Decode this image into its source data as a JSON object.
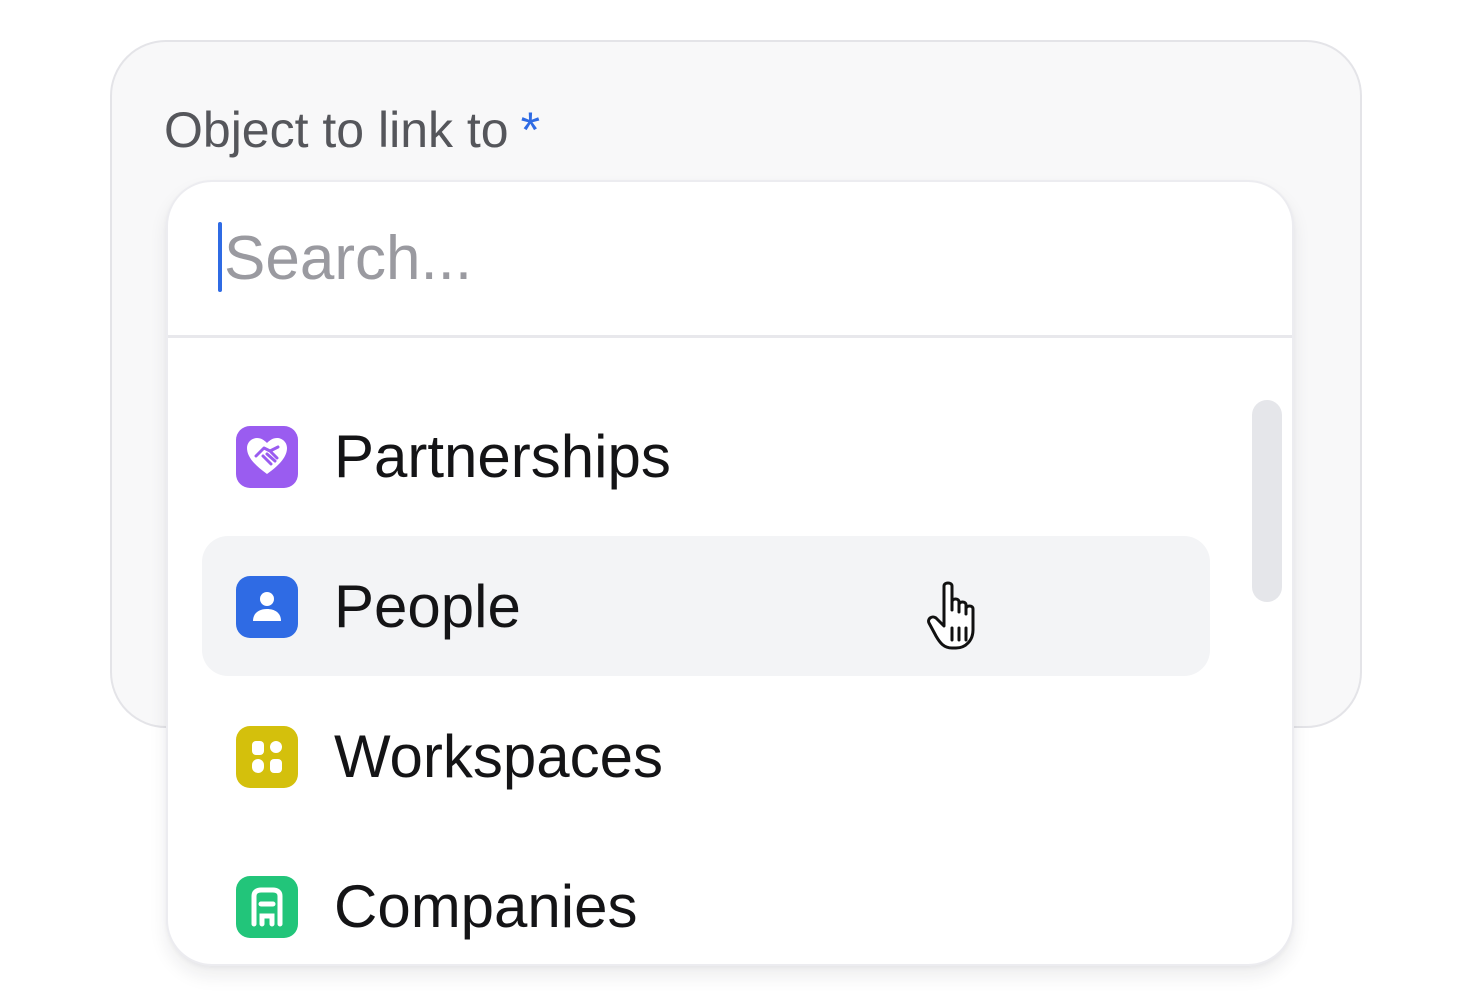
{
  "field": {
    "label": "Object to link to",
    "required_marker": "*"
  },
  "search": {
    "placeholder": "Search...",
    "value": ""
  },
  "objects": [
    {
      "label": "Partnerships",
      "icon": "handshake-heart-icon",
      "color": "#9a5cf0"
    },
    {
      "label": "People",
      "icon": "person-icon",
      "color": "#2f6be4",
      "hovered": true
    },
    {
      "label": "Workspaces",
      "icon": "grid-blocks-icon",
      "color": "#d4c00c"
    },
    {
      "label": "Companies",
      "icon": "building-icon",
      "color": "#22c57a"
    }
  ],
  "colors": {
    "accent": "#2f6be4",
    "hover_bg": "#f3f4f6"
  }
}
